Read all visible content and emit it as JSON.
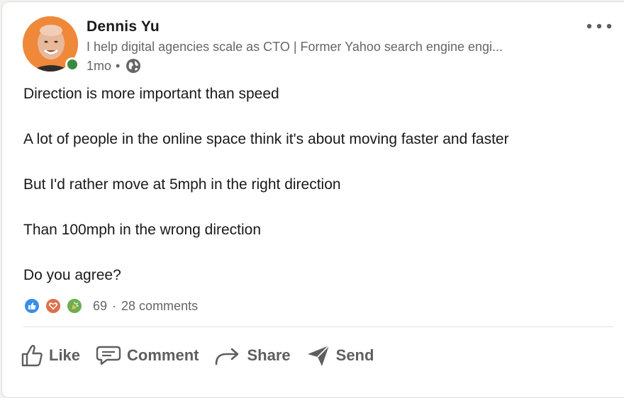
{
  "author": {
    "name": "Dennis Yu",
    "headline": "I help digital agencies scale as CTO | Former Yahoo search engine engi...",
    "time": "1mo",
    "visibility_icon": "globe-icon",
    "presence_color": "#3a8a3f"
  },
  "post": {
    "lines": [
      "Direction is more important than speed",
      "A lot of people in the online space think it's about moving faster and faster",
      "But I'd rather move at 5mph in the right direction",
      "Than 100mph in the wrong direction",
      "Do you agree?"
    ]
  },
  "social": {
    "reaction_icons": [
      "like-icon",
      "love-icon",
      "celebrate-icon"
    ],
    "reaction_count": "69",
    "comments": "28 comments"
  },
  "actions": {
    "like": "Like",
    "comment": "Comment",
    "share": "Share",
    "send": "Send"
  },
  "colors": {
    "like": "#378fe9",
    "love": "#df704d",
    "celebrate": "#44712e"
  }
}
